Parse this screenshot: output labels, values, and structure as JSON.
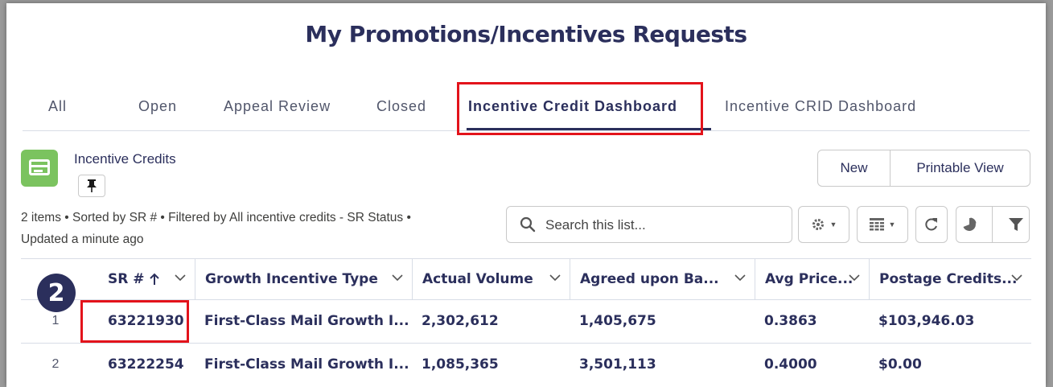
{
  "page": {
    "title": "My Promotions/Incentives Requests"
  },
  "tabs": [
    {
      "label": "All"
    },
    {
      "label": "Open"
    },
    {
      "label": "Appeal Review"
    },
    {
      "label": "Closed"
    },
    {
      "label": "Incentive Credit Dashboard",
      "active": true
    },
    {
      "label": "Incentive CRID Dashboard"
    }
  ],
  "list": {
    "title": "Incentive Credits",
    "meta_line1": "2 items • Sorted by SR # • Filtered by All incentive credits - SR Status •",
    "meta_line2": "Updated a minute ago",
    "new_label": "New",
    "printable_label": "Printable View",
    "search_placeholder": "Search this list..."
  },
  "table": {
    "columns": [
      {
        "label": "SR #",
        "sorted": "ascending",
        "sort_icon": "arrow-up-icon"
      },
      {
        "label": "Growth Incentive Type"
      },
      {
        "label": "Actual Volume"
      },
      {
        "label": "Agreed upon Ba..."
      },
      {
        "label": "Avg Price..."
      },
      {
        "label": "Postage Credits..."
      }
    ],
    "rows": [
      {
        "num": "1",
        "sr": "63221930",
        "type": "First-Class Mail Growth I...",
        "actual": "2,302,612",
        "agreed": "1,405,675",
        "avg": "0.3863",
        "credits": "$103,946.03"
      },
      {
        "num": "2",
        "sr": "63222254",
        "type": "First-Class Mail Growth I...",
        "actual": "1,085,365",
        "agreed": "3,501,113",
        "avg": "0.4000",
        "credits": "$0.00"
      }
    ]
  },
  "annotation": {
    "step": "2"
  },
  "colors": {
    "accent": "#2b2f5c",
    "highlight": "#e3131b",
    "list_icon_bg": "#7bc35f"
  }
}
